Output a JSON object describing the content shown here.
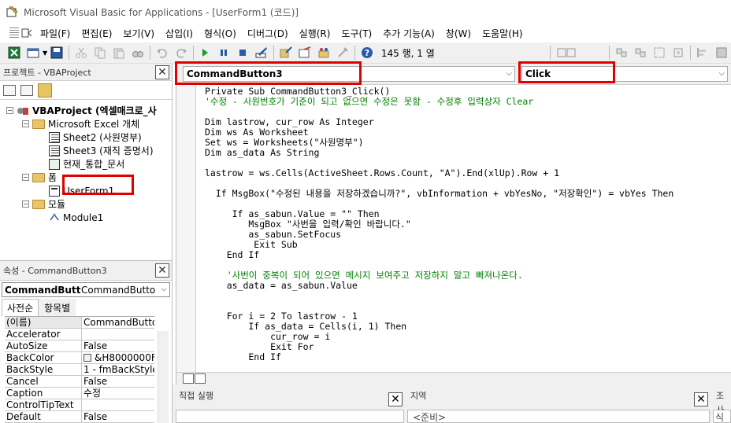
{
  "window": {
    "title": "Microsoft Visual Basic for Applications - [UserForm1 (코드)]"
  },
  "menu": [
    "파일(F)",
    "편집(E)",
    "보기(V)",
    "삽입(I)",
    "형식(O)",
    "디버그(D)",
    "실행(R)",
    "도구(T)",
    "추가 기능(A)",
    "창(W)",
    "도움말(H)"
  ],
  "toolbar": {
    "cursor_position": "145 행, 1 열",
    "icons": [
      "excel-icon",
      "insert-userform-icon",
      "save-icon",
      "cut-icon",
      "copy-icon",
      "paste-icon",
      "find-icon",
      "undo-icon",
      "redo-icon",
      "run-icon",
      "break-icon",
      "reset-icon",
      "design-mode-icon",
      "project-explorer-icon",
      "properties-icon",
      "object-browser-icon",
      "toolbox-icon",
      "help-icon"
    ]
  },
  "project_panel": {
    "title": "프로젝트 - VBAProject",
    "tree": {
      "root": "VBAProject (엑셀매크로_사",
      "excel_folder": "Microsoft Excel 개체",
      "sheets": [
        "Sheet2 (사원명부)",
        "Sheet3 (재직 증명서)",
        "현재_통합_문서"
      ],
      "forms_folder": "폼",
      "forms": [
        "UserForm1"
      ],
      "modules_folder": "모듈",
      "modules": [
        "Module1"
      ]
    }
  },
  "properties_panel": {
    "title": "속성 - CommandButton3",
    "object_name": "CommandButtc",
    "object_type": "CommandButtor",
    "tabs": [
      "사전순",
      "항목별"
    ],
    "rows": [
      {
        "name": "(이름)",
        "value": "CommandButto"
      },
      {
        "name": "Accelerator",
        "value": ""
      },
      {
        "name": "AutoSize",
        "value": "False"
      },
      {
        "name": "BackColor",
        "value": "&H8000000F&"
      },
      {
        "name": "BackStyle",
        "value": "1 - fmBackStyle"
      },
      {
        "name": "Cancel",
        "value": "False"
      },
      {
        "name": "Caption",
        "value": "수정"
      },
      {
        "name": "ControlTipText",
        "value": ""
      },
      {
        "name": "Default",
        "value": "False"
      }
    ]
  },
  "code_window": {
    "object_combo": "CommandButton3",
    "procedure_combo": "Click",
    "lines": [
      {
        "text": "Private Sub CommandButton3_Click()",
        "comment": false
      },
      {
        "text": "'수정 - 사원번호가 기준이 되고 없으면 수정은 못함 - 수정후 입력상자 Clear",
        "comment": true
      },
      {
        "text": "",
        "comment": false
      },
      {
        "text": "Dim lastrow, cur_row As Integer",
        "comment": false
      },
      {
        "text": "Dim ws As Worksheet",
        "comment": false
      },
      {
        "text": "Set ws = Worksheets(\"사원명부\")",
        "comment": false
      },
      {
        "text": "Dim as_data As String",
        "comment": false
      },
      {
        "text": "",
        "comment": false
      },
      {
        "text": "lastrow = ws.Cells(ActiveSheet.Rows.Count, \"A\").End(xlUp).Row + 1",
        "comment": false
      },
      {
        "text": "",
        "comment": false
      },
      {
        "text": "  If MsgBox(\"수정된 내용을 저장하겠습니까?\", vbInformation + vbYesNo, \"저장확인\") = vbYes Then",
        "comment": false
      },
      {
        "text": "",
        "comment": false
      },
      {
        "text": "     If as_sabun.Value = \"\" Then",
        "comment": false
      },
      {
        "text": "        MsgBox \"사번을 입력/확인 바랍니다.\"",
        "comment": false
      },
      {
        "text": "        as_sabun.SetFocus",
        "comment": false
      },
      {
        "text": "         Exit Sub",
        "comment": false
      },
      {
        "text": "    End If",
        "comment": false
      },
      {
        "text": "",
        "comment": false
      },
      {
        "text": "    '사번이 중복이 되어 있으면 메시지 보여주고 저장하지 말고 빠져나온다.",
        "comment": true
      },
      {
        "text": "    as_data = as_sabun.Value",
        "comment": false
      },
      {
        "text": "",
        "comment": false
      },
      {
        "text": "",
        "comment": false
      },
      {
        "text": "    For i = 2 To lastrow - 1",
        "comment": false
      },
      {
        "text": "        If as_data = Cells(i, 1) Then",
        "comment": false
      },
      {
        "text": "            cur_row = i",
        "comment": false
      },
      {
        "text": "            Exit For",
        "comment": false
      },
      {
        "text": "        End If",
        "comment": false
      }
    ]
  },
  "bottom": {
    "immediate_title": "직접 실행",
    "locals_title": "지역",
    "locals_status": "<준비>",
    "watch_title": "조사",
    "watch_body": "식"
  },
  "colors": {
    "highlight": "#e00000",
    "comment": "#008000"
  }
}
